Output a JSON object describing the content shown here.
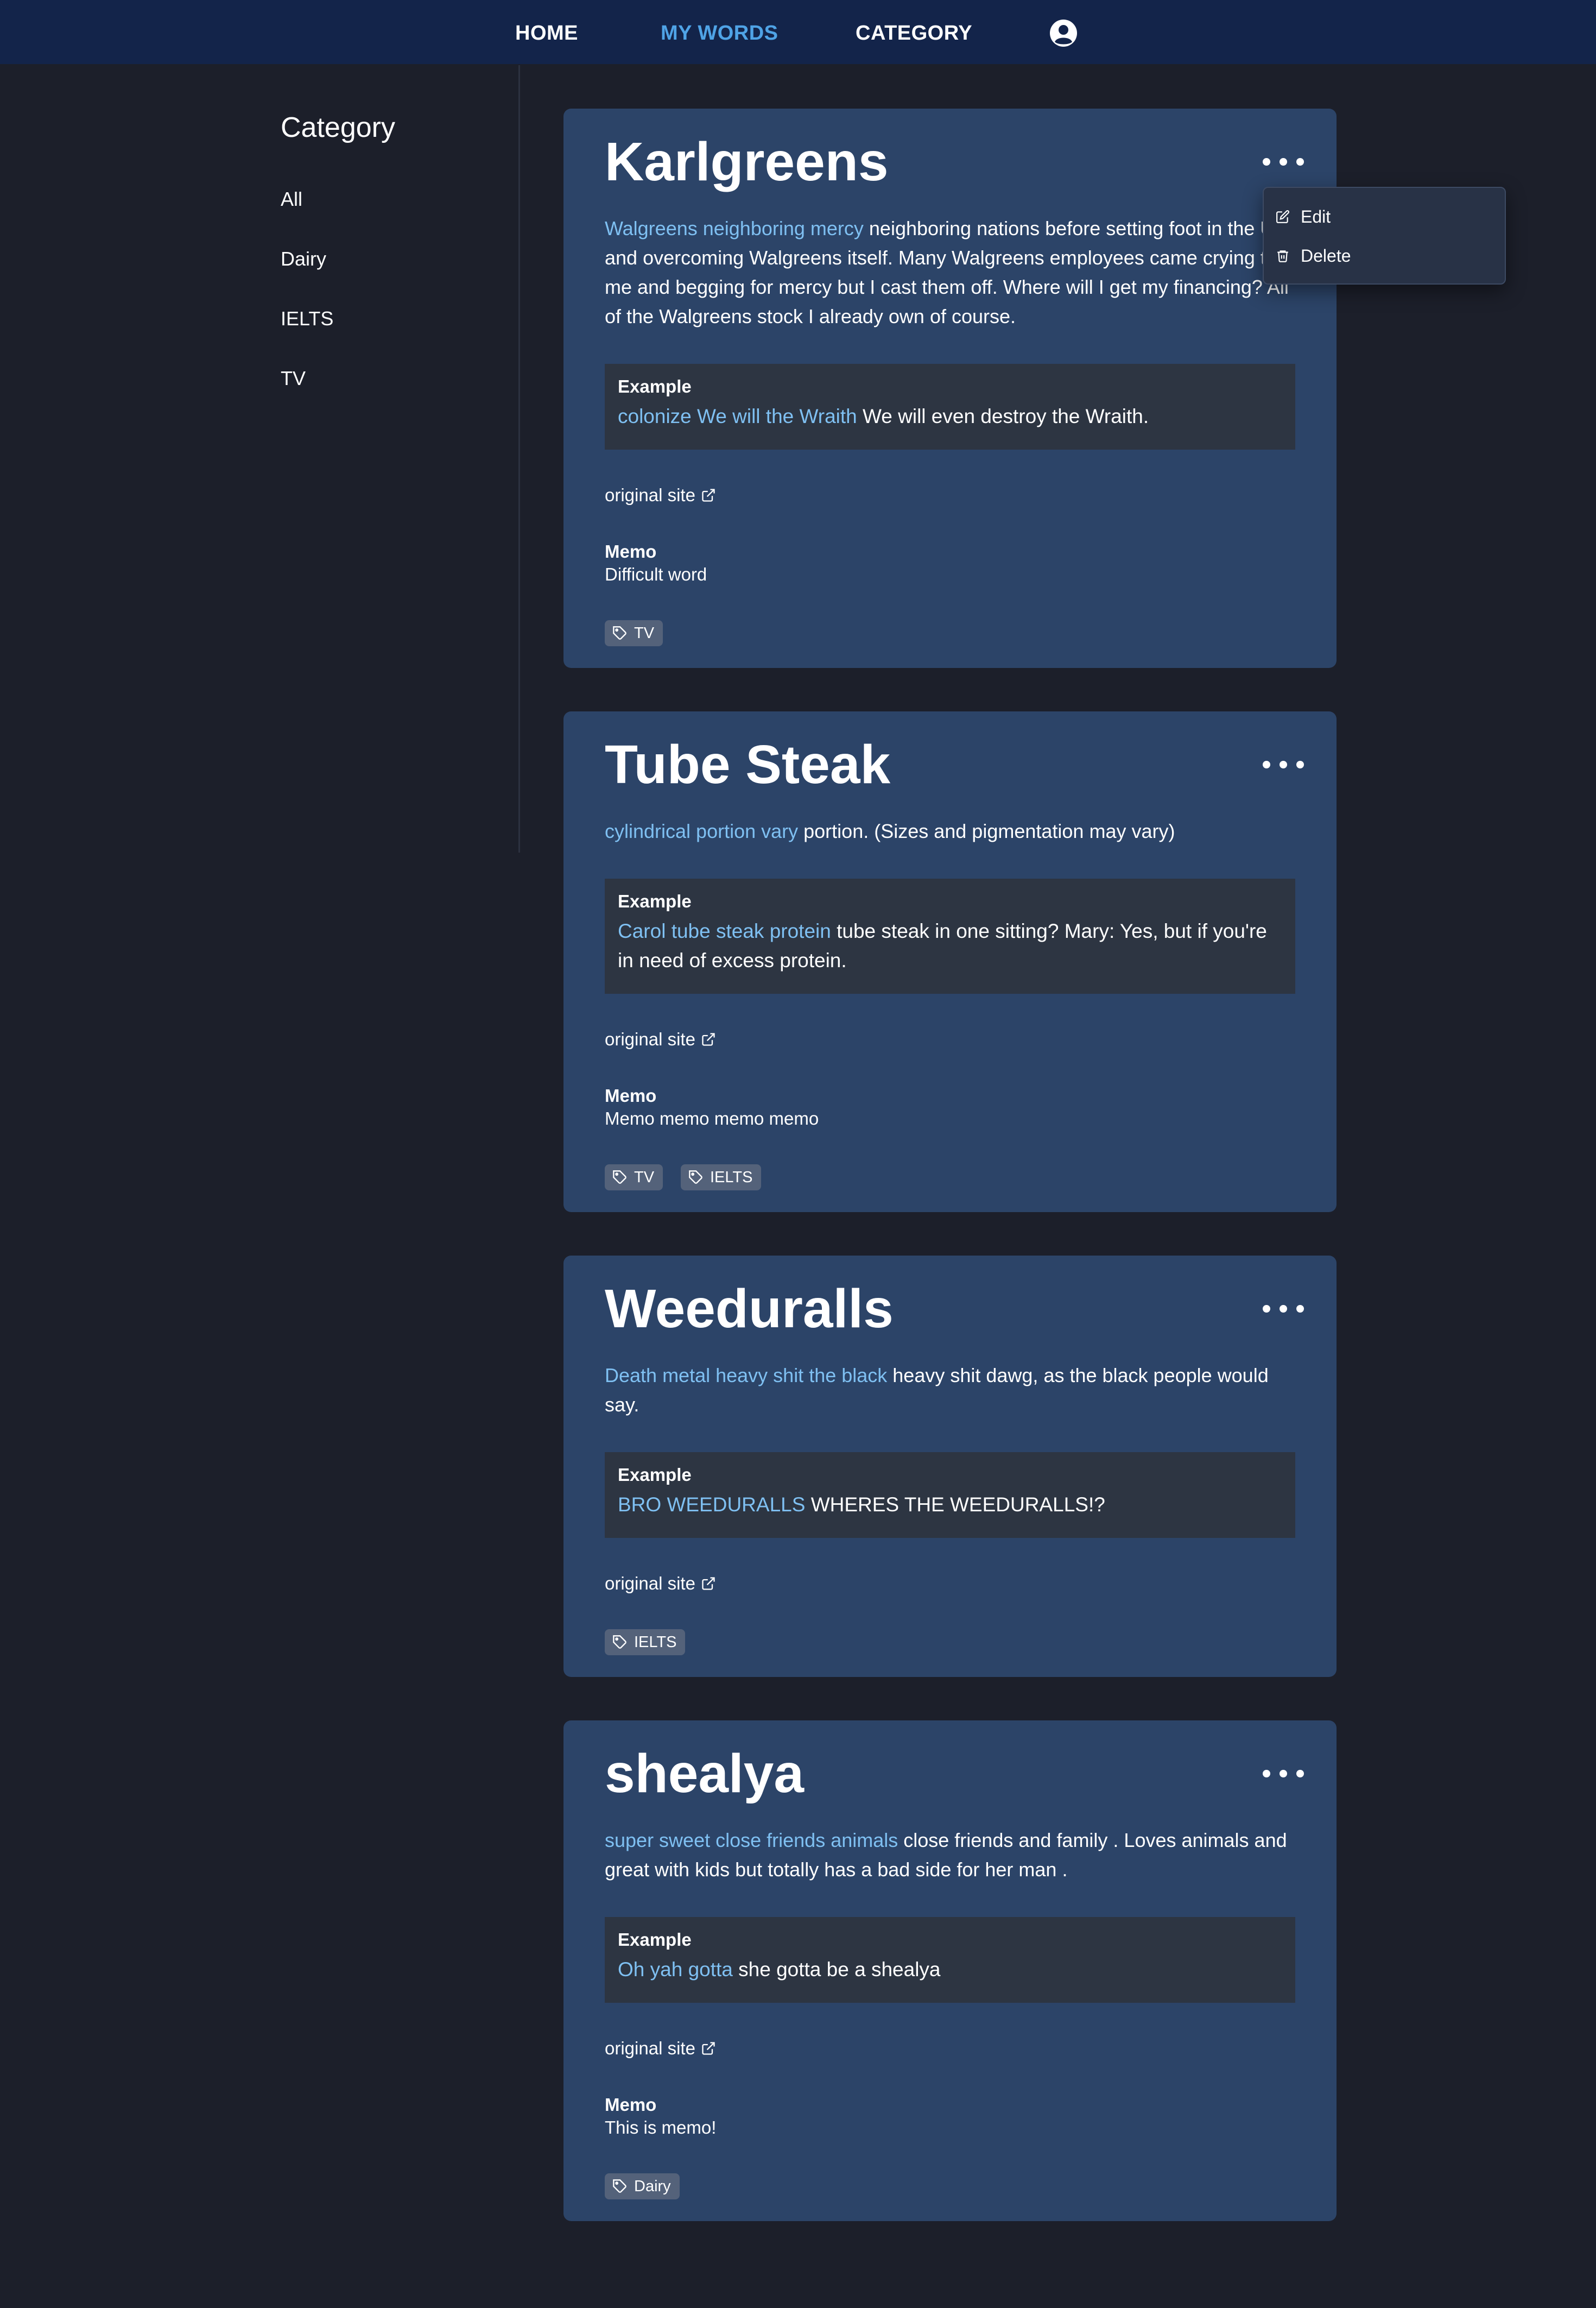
{
  "nav": {
    "home": "HOME",
    "my_words": "MY WORDS",
    "category": "CATEGORY",
    "active_color": "#4fa3e6",
    "account_icon": "user-circle-icon"
  },
  "sidebar": {
    "title": "Category",
    "items": [
      {
        "label": "All"
      },
      {
        "label": "Dairy"
      },
      {
        "label": "IELTS"
      },
      {
        "label": "TV"
      }
    ]
  },
  "menu": {
    "edit": "Edit",
    "delete": "Delete",
    "edit_icon": "edit-icon",
    "delete_icon": "trash-icon"
  },
  "labels": {
    "example": "Example",
    "original_site": "original site",
    "memo": "Memo"
  },
  "words": [
    {
      "title": "Karlgreens",
      "definition_highlight": "Walgreens neighboring mercy",
      "definition": " neighboring nations before setting foot in the U.S. and overcoming Walgreens itself. Many Walgreens employees came crying to me and begging for mercy but I cast them off. Where will I get my financing? All of the Walgreens stock I already own of course.",
      "example_highlight": "colonize We will the Wraith",
      "example": " We will even destroy the Wraith.",
      "memo": "Difficult word",
      "tags": [
        "TV"
      ]
    },
    {
      "title": "Tube Steak",
      "definition_highlight": "cylindrical portion vary",
      "definition": " portion. (Sizes and pigmentation may vary)",
      "example_highlight": "Carol tube steak protein",
      "example": " tube steak in one sitting? Mary: Yes, but if you're in need of excess protein.",
      "memo": "Memo memo memo memo",
      "tags": [
        "TV",
        "IELTS"
      ]
    },
    {
      "title": "Weeduralls",
      "definition_highlight": "Death metal heavy shit the black",
      "definition": " heavy shit dawg, as the black people would say.",
      "example_highlight": "BRO WEEDURALLS",
      "example": "  WHERES THE WEEDURALLS!?",
      "tags": [
        "IELTS"
      ]
    },
    {
      "title": "shealya",
      "definition_highlight": "super sweet close friends animals",
      "definition": " close friends and family . Loves animals and great with kids but totally has a bad side for her man .",
      "example_highlight": "Oh yah gotta",
      "example": "  she gotta be a shealya",
      "memo": "This is memo!",
      "tags": [
        "Dairy"
      ]
    }
  ]
}
